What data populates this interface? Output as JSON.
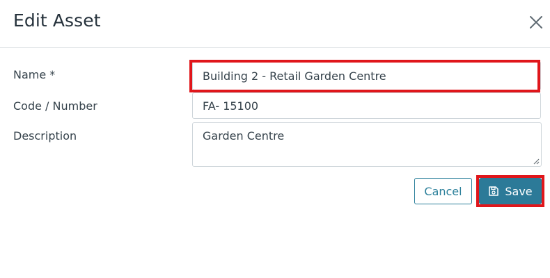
{
  "modal": {
    "title": "Edit Asset",
    "close_icon": "close-icon"
  },
  "form": {
    "name": {
      "label": "Name *",
      "value": "Building 2 - Retail Garden Centre"
    },
    "code": {
      "label": "Code / Number",
      "value": "FA- 15100"
    },
    "description": {
      "label": "Description",
      "value": "Garden Centre"
    }
  },
  "actions": {
    "cancel_label": "Cancel",
    "save_label": "Save",
    "save_icon": "floppy-disk-icon"
  },
  "colors": {
    "accent": "#2c7a98",
    "highlight": "#e0161b",
    "text": "#36434c"
  }
}
